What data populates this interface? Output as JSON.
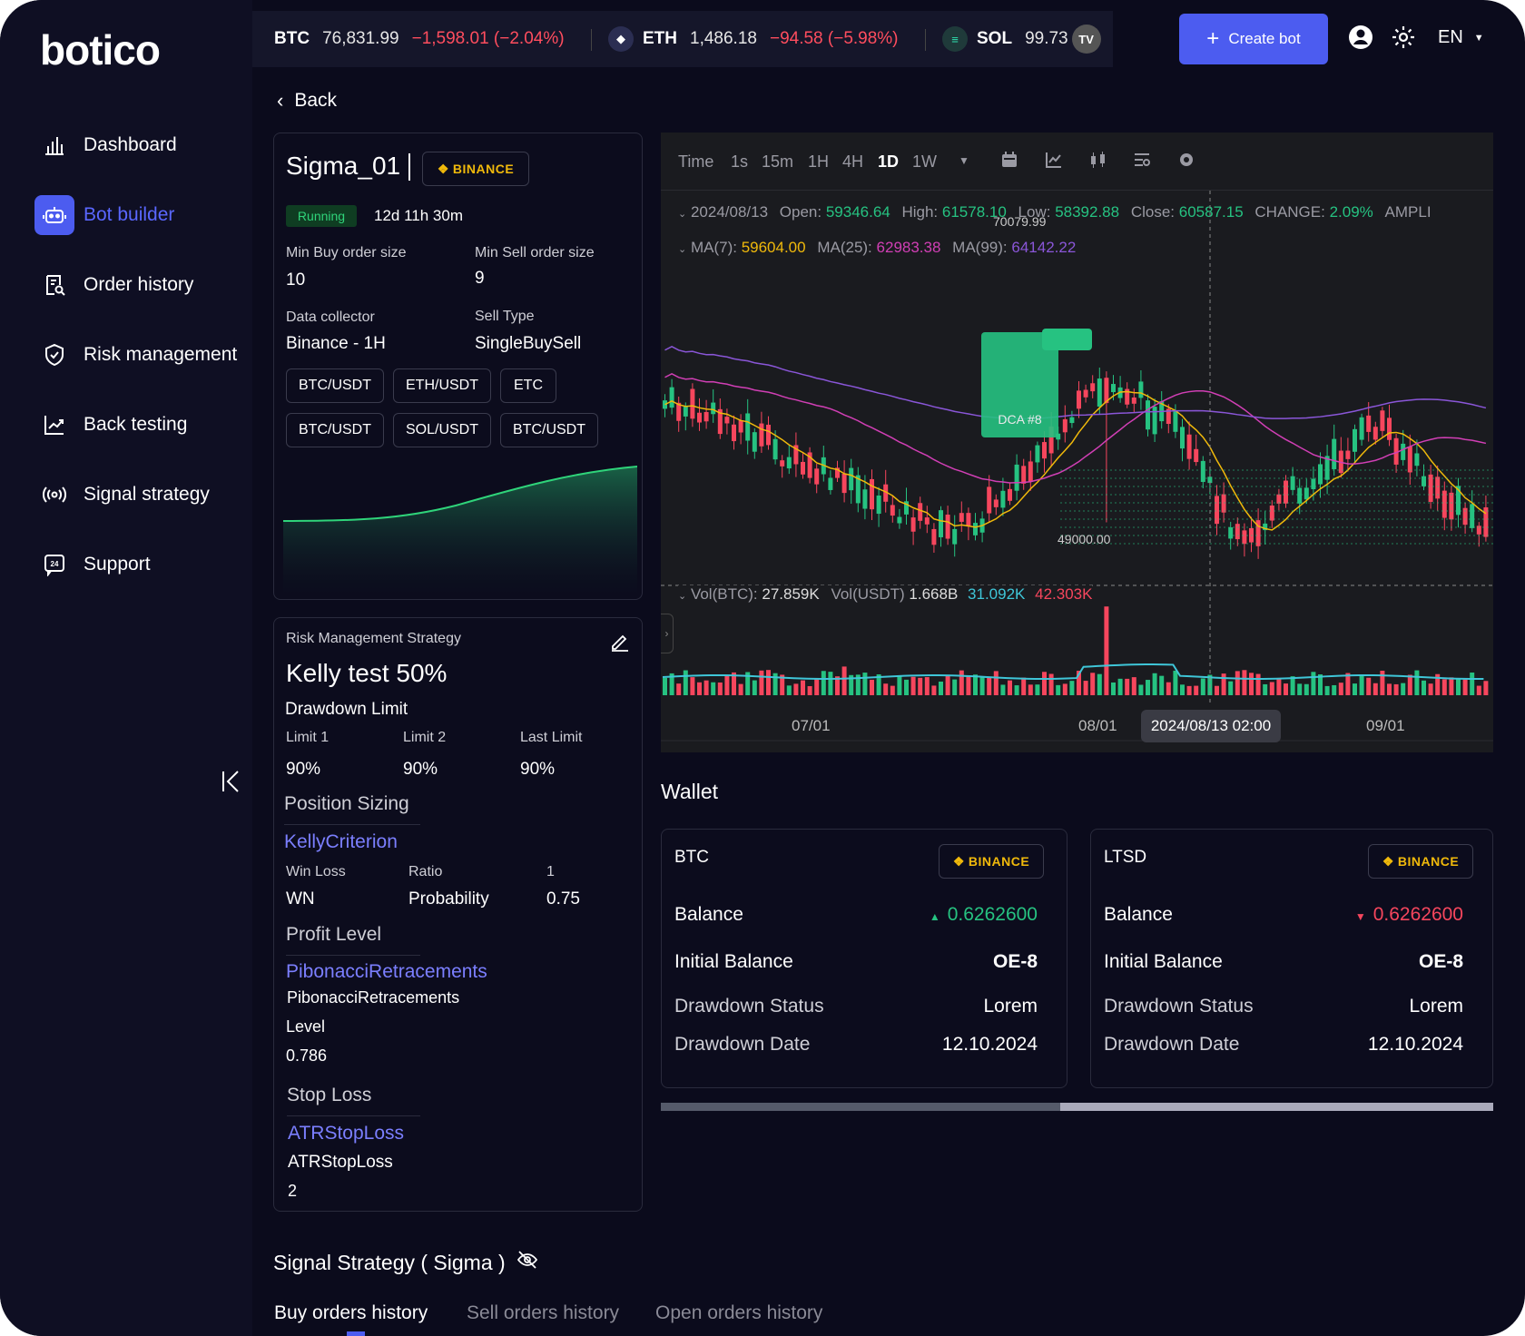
{
  "brand": {
    "logo": "botico"
  },
  "sidebar": {
    "items": [
      {
        "label": "Dashboard",
        "icon": "bar-chart-icon"
      },
      {
        "label": "Bot builder",
        "icon": "robot-icon",
        "active": true
      },
      {
        "label": "Order history",
        "icon": "receipt-search-icon"
      },
      {
        "label": "Risk management",
        "icon": "shield-check-icon"
      },
      {
        "label": "Back testing",
        "icon": "trend-chart-icon"
      },
      {
        "label": "Signal  strategy",
        "icon": "signal-broadcast-icon"
      },
      {
        "label": "Support",
        "icon": "support-24-icon"
      }
    ]
  },
  "ticker": [
    {
      "symbol": "BTC",
      "price": "76,831.99",
      "change": "−1,598.01 (−2.04%)"
    },
    {
      "symbol": "ETH",
      "price": "1,486.18",
      "change": "−94.58 (−5.98%)"
    },
    {
      "symbol": "SOL",
      "price": "99.73",
      "change": ""
    }
  ],
  "header": {
    "create_bot": "Create bot",
    "lang": "EN",
    "back": "Back",
    "tv_badge": "TV"
  },
  "bot": {
    "name": "Sigma_01",
    "exchange": "BINANCE",
    "status": "Running",
    "uptime": "12d 11h 30m",
    "min_buy_label": "Min Buy order size",
    "min_buy": "10",
    "min_sell_label": "Min Sell order size",
    "min_sell": "9",
    "collector_label": "Data collector",
    "collector": "Binance - 1H",
    "sell_type_label": "Sell Type",
    "sell_type": "SingleBuySell",
    "pairs": [
      "BTC/USDT",
      "ETH/USDT",
      "ETC",
      "BTC/USDT",
      "SOL/USDT",
      "BTC/USDT"
    ]
  },
  "risk": {
    "header": "Risk Management Strategy",
    "name": "Kelly test 50%",
    "drawdown_title": "Drawdown Limit",
    "limits": [
      {
        "label": "Limit 1",
        "value": "90%"
      },
      {
        "label": "Limit 2",
        "value": "90%"
      },
      {
        "label": "Last Limit",
        "value": "90%"
      }
    ],
    "position_title": "Position Sizing",
    "position_method": "KellyCriterion",
    "pos_cols": [
      {
        "label": "Win Loss",
        "value": "WN"
      },
      {
        "label": "Ratio",
        "value": "Probability"
      },
      {
        "label": "1",
        "value": "0.75"
      }
    ],
    "profit_title": "Profit Level",
    "profit_method": "PibonacciRetracements",
    "profit_name": "PibonacciRetracements",
    "profit_level_label": "Level",
    "profit_level": "0.786",
    "stop_title": "Stop Loss",
    "stop_method": "ATRStopLoss",
    "stop_name": "ATRStopLoss",
    "stop_value": "2"
  },
  "chart": {
    "intervals": [
      "Time",
      "1s",
      "15m",
      "1H",
      "4H",
      "1D",
      "1W"
    ],
    "active_interval": "1D",
    "ohlc": {
      "date": "2024/08/13",
      "open_l": "Open:",
      "open": "59346.64",
      "high_l": "High:",
      "high": "61578.10",
      "low_l": "Low:",
      "low": "58392.88",
      "close_l": "Close:",
      "close": "60587.15",
      "change_l": "CHANGE:",
      "change": "2.09%",
      "ampl": "AMPLI"
    },
    "ma": {
      "ma7_l": "MA(7):",
      "ma7": "59604.00",
      "ma25_l": "MA(25):",
      "ma25": "62983.38",
      "ma99_l": "MA(99):",
      "ma99": "64142.22"
    },
    "high_marker": "70079.99",
    "low_marker": "49000.00",
    "order_label": "DCA #8",
    "vol": {
      "btc_l": "Vol(BTC):",
      "btc": "27.859K",
      "usdt_l": "Vol(USDT)",
      "usdt": "1.668B",
      "v1": "31.092K",
      "v2": "42.303K"
    },
    "x_ticks": [
      "07/01",
      "08/01",
      "09/01"
    ],
    "crosshair_label": "2024/08/13 02:00",
    "colors": {
      "up": "#26c281",
      "down": "#f6465d",
      "ma7": "#f0b90b",
      "ma25": "#d13fb5",
      "ma99": "#8a56d8"
    }
  },
  "wallet": {
    "title": "Wallet",
    "cards": [
      {
        "asset": "BTC",
        "exchange": "BINANCE",
        "balance_label": "Balance",
        "balance": "0.6262600",
        "trend": "up",
        "initial_label": "Initial Balance",
        "initial": "OE-8",
        "dd_status_label": "Drawdown Status",
        "dd_status": "Lorem",
        "dd_date_label": "Drawdown Date",
        "dd_date": "12.10.2024"
      },
      {
        "asset": "LTSD",
        "exchange": "BINANCE",
        "balance_label": "Balance",
        "balance": "0.6262600",
        "trend": "down",
        "initial_label": "Initial Balance",
        "initial": "OE-8",
        "dd_status_label": "Drawdown Status",
        "dd_status": "Lorem",
        "dd_date_label": "Drawdown Date",
        "dd_date": "12.10.2024"
      }
    ]
  },
  "signal": {
    "title": "Signal Strategy ( Sigma )",
    "tabs": [
      "Buy orders history",
      "Sell orders history",
      "Open orders history"
    ]
  }
}
